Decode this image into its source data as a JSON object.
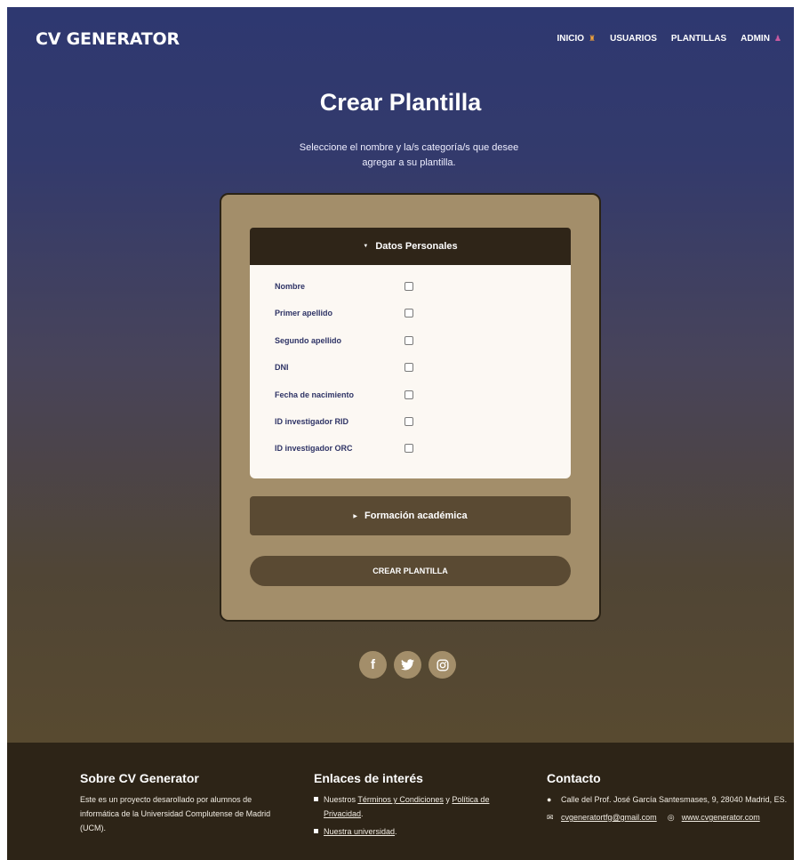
{
  "brand": "CV GENERATOR",
  "nav": [
    {
      "label": "INICIO",
      "icon": "house-icon"
    },
    {
      "label": "USUARIOS",
      "icon": ""
    },
    {
      "label": "PLANTILLAS",
      "icon": ""
    },
    {
      "label": "ADMIN",
      "icon": "person-icon"
    }
  ],
  "hero": {
    "title": "Crear Plantilla",
    "subtitle": "Seleccione el nombre y la/s categoría/s que desee agregar a su plantilla."
  },
  "form": {
    "section1_label": "Datos Personales",
    "fields": [
      {
        "label": "Nombre",
        "checked": false
      },
      {
        "label": "Primer apellido",
        "checked": false
      },
      {
        "label": "Segundo apellido",
        "checked": false
      },
      {
        "label": "DNI",
        "checked": false
      },
      {
        "label": "Fecha de nacimiento",
        "checked": false
      },
      {
        "label": "ID investigador RID",
        "checked": false
      },
      {
        "label": "ID investigador ORC",
        "checked": false
      }
    ],
    "section2_label": "Formación académica",
    "submit_label": "CREAR PLANTILLA"
  },
  "social": [
    "facebook-icon",
    "twitter-icon",
    "instagram-icon"
  ],
  "footer": {
    "about": {
      "title": "Sobre CV Generator",
      "text": "Este es un proyecto desarollado por alumnos de informática de la Universidad Complutense de Madrid (UCM)."
    },
    "links": {
      "title": "Enlaces de interés",
      "item1_prefix": "Nuestros ",
      "item1_link1": "Términos y Condiciones",
      "item1_mid": " y ",
      "item1_link2": "Política de Privacidad",
      "item1_suffix": ".",
      "item2_link": "Nuestra universidad",
      "item2_suffix": "."
    },
    "contact": {
      "title": "Contacto",
      "address": "Calle del Prof. José García Santesmases, 9, 28040 Madrid, ES.",
      "email": "cvgeneratortfg@gmail.com",
      "website": "www.cvgenerator.com"
    }
  }
}
